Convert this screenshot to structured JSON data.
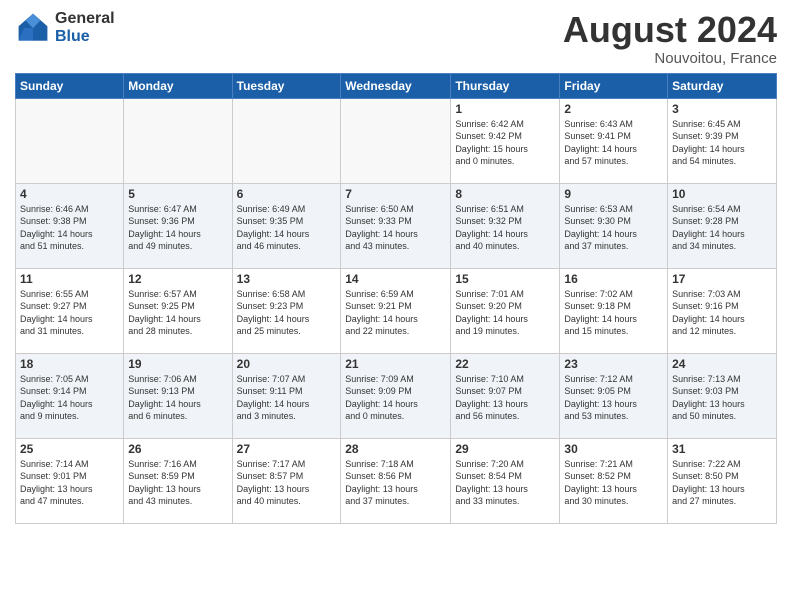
{
  "header": {
    "logo_general": "General",
    "logo_blue": "Blue",
    "title": "August 2024",
    "location": "Nouvoitou, France"
  },
  "weekdays": [
    "Sunday",
    "Monday",
    "Tuesday",
    "Wednesday",
    "Thursday",
    "Friday",
    "Saturday"
  ],
  "weeks": [
    {
      "row_class": "row-1",
      "days": [
        {
          "num": "",
          "info": "",
          "empty": true
        },
        {
          "num": "",
          "info": "",
          "empty": true
        },
        {
          "num": "",
          "info": "",
          "empty": true
        },
        {
          "num": "",
          "info": "",
          "empty": true
        },
        {
          "num": "1",
          "info": "Sunrise: 6:42 AM\nSunset: 9:42 PM\nDaylight: 15 hours\nand 0 minutes.",
          "empty": false
        },
        {
          "num": "2",
          "info": "Sunrise: 6:43 AM\nSunset: 9:41 PM\nDaylight: 14 hours\nand 57 minutes.",
          "empty": false
        },
        {
          "num": "3",
          "info": "Sunrise: 6:45 AM\nSunset: 9:39 PM\nDaylight: 14 hours\nand 54 minutes.",
          "empty": false
        }
      ]
    },
    {
      "row_class": "row-2",
      "days": [
        {
          "num": "4",
          "info": "Sunrise: 6:46 AM\nSunset: 9:38 PM\nDaylight: 14 hours\nand 51 minutes.",
          "empty": false
        },
        {
          "num": "5",
          "info": "Sunrise: 6:47 AM\nSunset: 9:36 PM\nDaylight: 14 hours\nand 49 minutes.",
          "empty": false
        },
        {
          "num": "6",
          "info": "Sunrise: 6:49 AM\nSunset: 9:35 PM\nDaylight: 14 hours\nand 46 minutes.",
          "empty": false
        },
        {
          "num": "7",
          "info": "Sunrise: 6:50 AM\nSunset: 9:33 PM\nDaylight: 14 hours\nand 43 minutes.",
          "empty": false
        },
        {
          "num": "8",
          "info": "Sunrise: 6:51 AM\nSunset: 9:32 PM\nDaylight: 14 hours\nand 40 minutes.",
          "empty": false
        },
        {
          "num": "9",
          "info": "Sunrise: 6:53 AM\nSunset: 9:30 PM\nDaylight: 14 hours\nand 37 minutes.",
          "empty": false
        },
        {
          "num": "10",
          "info": "Sunrise: 6:54 AM\nSunset: 9:28 PM\nDaylight: 14 hours\nand 34 minutes.",
          "empty": false
        }
      ]
    },
    {
      "row_class": "row-3",
      "days": [
        {
          "num": "11",
          "info": "Sunrise: 6:55 AM\nSunset: 9:27 PM\nDaylight: 14 hours\nand 31 minutes.",
          "empty": false
        },
        {
          "num": "12",
          "info": "Sunrise: 6:57 AM\nSunset: 9:25 PM\nDaylight: 14 hours\nand 28 minutes.",
          "empty": false
        },
        {
          "num": "13",
          "info": "Sunrise: 6:58 AM\nSunset: 9:23 PM\nDaylight: 14 hours\nand 25 minutes.",
          "empty": false
        },
        {
          "num": "14",
          "info": "Sunrise: 6:59 AM\nSunset: 9:21 PM\nDaylight: 14 hours\nand 22 minutes.",
          "empty": false
        },
        {
          "num": "15",
          "info": "Sunrise: 7:01 AM\nSunset: 9:20 PM\nDaylight: 14 hours\nand 19 minutes.",
          "empty": false
        },
        {
          "num": "16",
          "info": "Sunrise: 7:02 AM\nSunset: 9:18 PM\nDaylight: 14 hours\nand 15 minutes.",
          "empty": false
        },
        {
          "num": "17",
          "info": "Sunrise: 7:03 AM\nSunset: 9:16 PM\nDaylight: 14 hours\nand 12 minutes.",
          "empty": false
        }
      ]
    },
    {
      "row_class": "row-4",
      "days": [
        {
          "num": "18",
          "info": "Sunrise: 7:05 AM\nSunset: 9:14 PM\nDaylight: 14 hours\nand 9 minutes.",
          "empty": false
        },
        {
          "num": "19",
          "info": "Sunrise: 7:06 AM\nSunset: 9:13 PM\nDaylight: 14 hours\nand 6 minutes.",
          "empty": false
        },
        {
          "num": "20",
          "info": "Sunrise: 7:07 AM\nSunset: 9:11 PM\nDaylight: 14 hours\nand 3 minutes.",
          "empty": false
        },
        {
          "num": "21",
          "info": "Sunrise: 7:09 AM\nSunset: 9:09 PM\nDaylight: 14 hours\nand 0 minutes.",
          "empty": false
        },
        {
          "num": "22",
          "info": "Sunrise: 7:10 AM\nSunset: 9:07 PM\nDaylight: 13 hours\nand 56 minutes.",
          "empty": false
        },
        {
          "num": "23",
          "info": "Sunrise: 7:12 AM\nSunset: 9:05 PM\nDaylight: 13 hours\nand 53 minutes.",
          "empty": false
        },
        {
          "num": "24",
          "info": "Sunrise: 7:13 AM\nSunset: 9:03 PM\nDaylight: 13 hours\nand 50 minutes.",
          "empty": false
        }
      ]
    },
    {
      "row_class": "row-5",
      "days": [
        {
          "num": "25",
          "info": "Sunrise: 7:14 AM\nSunset: 9:01 PM\nDaylight: 13 hours\nand 47 minutes.",
          "empty": false
        },
        {
          "num": "26",
          "info": "Sunrise: 7:16 AM\nSunset: 8:59 PM\nDaylight: 13 hours\nand 43 minutes.",
          "empty": false
        },
        {
          "num": "27",
          "info": "Sunrise: 7:17 AM\nSunset: 8:57 PM\nDaylight: 13 hours\nand 40 minutes.",
          "empty": false
        },
        {
          "num": "28",
          "info": "Sunrise: 7:18 AM\nSunset: 8:56 PM\nDaylight: 13 hours\nand 37 minutes.",
          "empty": false
        },
        {
          "num": "29",
          "info": "Sunrise: 7:20 AM\nSunset: 8:54 PM\nDaylight: 13 hours\nand 33 minutes.",
          "empty": false
        },
        {
          "num": "30",
          "info": "Sunrise: 7:21 AM\nSunset: 8:52 PM\nDaylight: 13 hours\nand 30 minutes.",
          "empty": false
        },
        {
          "num": "31",
          "info": "Sunrise: 7:22 AM\nSunset: 8:50 PM\nDaylight: 13 hours\nand 27 minutes.",
          "empty": false
        }
      ]
    }
  ]
}
